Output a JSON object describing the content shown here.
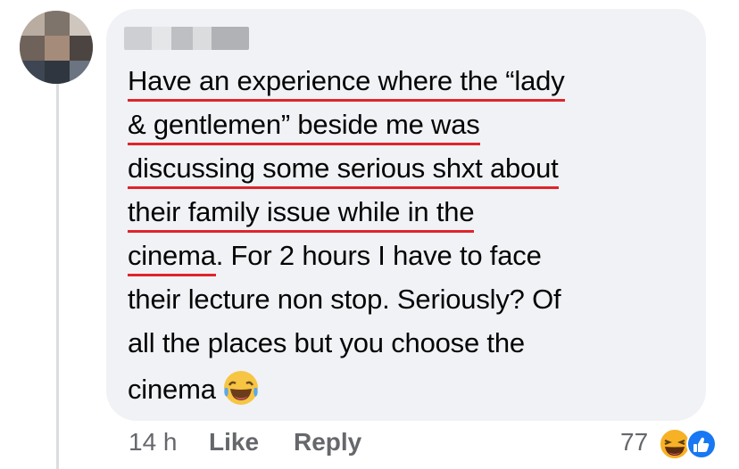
{
  "comment": {
    "lines": [
      "Have an experience where the “lady",
      "& gentlemen” beside me was",
      "discussing some serious shxt about",
      "their family issue while in the",
      "cinema",
      ". For 2 hours I have to face",
      "their lecture non stop. Seriously? Of",
      "all the places but you choose the",
      "cinema"
    ],
    "emoji_icon": "haha-laughing-emoji-icon"
  },
  "footer": {
    "time": "14 h",
    "like_label": "Like",
    "reply_label": "Reply",
    "reaction_count": "77"
  },
  "colors": {
    "bubble": "#f0f2f5",
    "underline": "#e0242b",
    "secondary_text": "#65676b",
    "like_blue": "#1877f2",
    "haha_yellow": "#f7b125"
  }
}
